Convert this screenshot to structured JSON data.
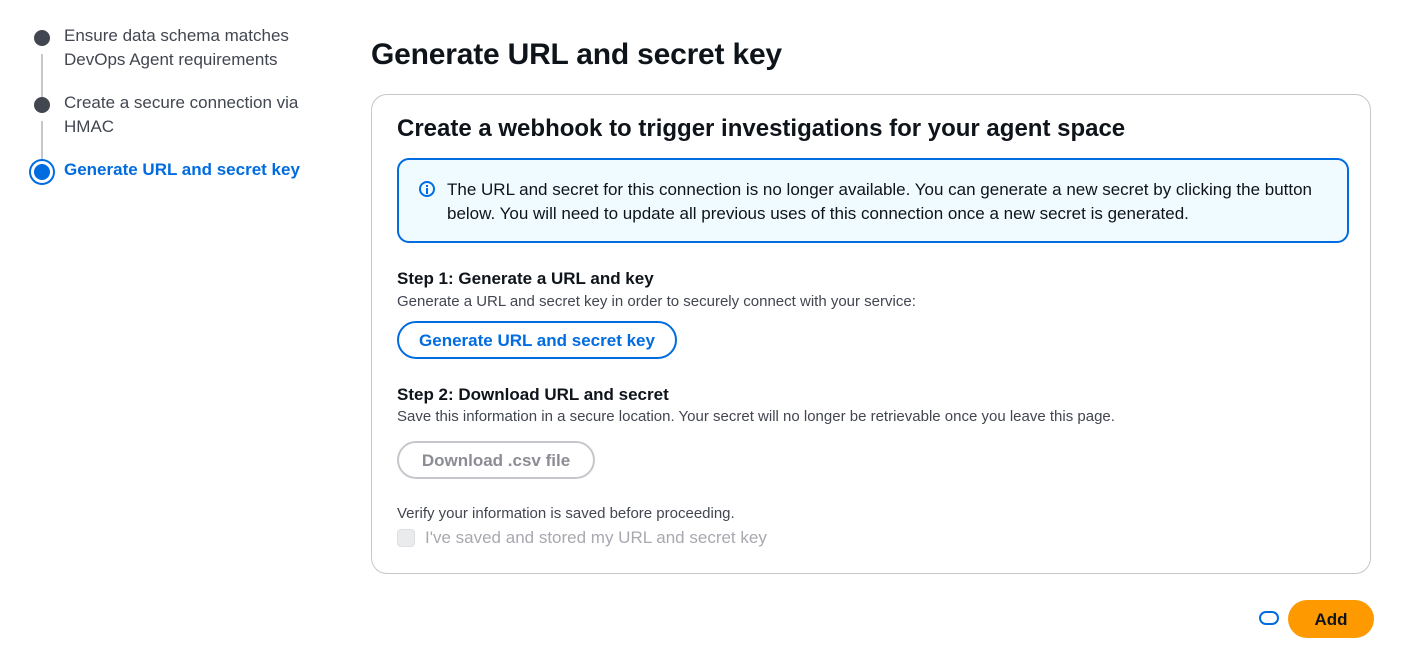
{
  "stepper": {
    "steps": [
      {
        "label": "Ensure data schema matches DevOps Agent requirements",
        "state": "done"
      },
      {
        "label": "Create a secure connection via HMAC",
        "state": "done"
      },
      {
        "label": "Generate URL and secret key",
        "state": "current"
      }
    ]
  },
  "page": {
    "title": "Generate URL and secret key"
  },
  "card": {
    "title": "Create a webhook to trigger investigations for your agent space",
    "alert": {
      "icon": "info-icon",
      "text": "The URL and secret for this connection is no longer available. You can generate a new secret by clicking the button below. You will need to update all previous uses of this connection once a new secret is generated."
    },
    "step1": {
      "heading": "Step 1: Generate a URL and key",
      "description": "Generate a URL and secret key in order to securely connect with your service:",
      "button_label": "Generate URL and secret key"
    },
    "step2": {
      "heading": "Step 2: Download URL and secret",
      "description": "Save this information in a secure location. Your secret will no longer be retrievable once you leave this page.",
      "button_label": "Download .csv file"
    },
    "verify_text": "Verify your information is saved before proceeding.",
    "checkbox_label": "I've saved and stored my URL and secret key"
  },
  "footer": {
    "add_label": "Add"
  },
  "colors": {
    "accent": "#006ce0",
    "primary_button": "#ff9900",
    "alert_bg": "#f0fbff"
  }
}
